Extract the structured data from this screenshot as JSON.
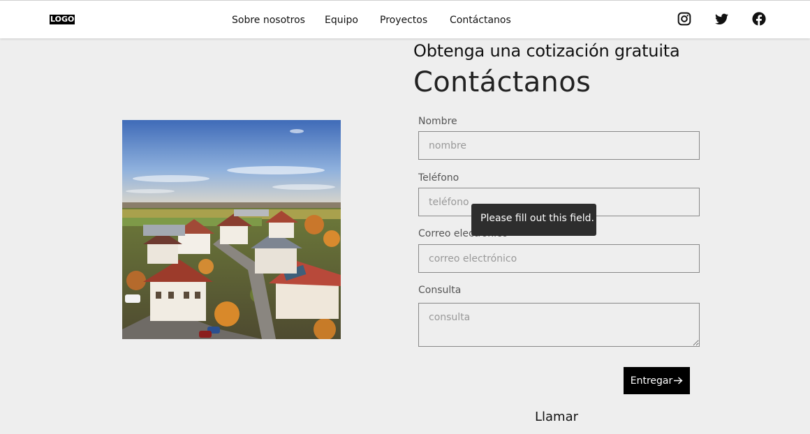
{
  "header": {
    "logo": "LOGO",
    "nav": [
      "Sobre nosotros",
      "Equipo",
      "Proyectos",
      "Contáctanos"
    ],
    "social": [
      "instagram-icon",
      "twitter-icon",
      "facebook-icon"
    ]
  },
  "hero": {
    "subtitle": "Obtenga una cotización gratuita",
    "title": "Contáctanos"
  },
  "form": {
    "name_label": "Nombre",
    "name_placeholder": "nombre",
    "phone_label": "Teléfono",
    "phone_placeholder": "teléfono",
    "email_label": "Correo electrónico",
    "email_placeholder": "correo electrónico",
    "query_label": "Consulta",
    "query_placeholder": "consulta",
    "tooltip": "Please fill out this field.",
    "submit_label": "Entregar",
    "call_label": "Llamar"
  },
  "colors": {
    "background": "#eeeeee",
    "header": "#ffffff",
    "button": "#000000",
    "tooltip": "#2d2d2d"
  }
}
